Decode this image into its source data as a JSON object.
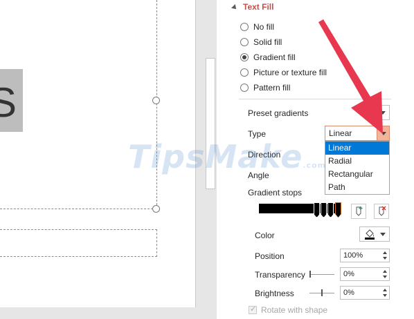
{
  "slide": {
    "shape_glyph": "S"
  },
  "pane": {
    "section_title": "Text Fill",
    "fill_options": [
      {
        "label": "No fill",
        "checked": false
      },
      {
        "label": "Solid fill",
        "checked": false
      },
      {
        "label": "Gradient fill",
        "checked": true
      },
      {
        "label": "Picture or texture fill",
        "checked": false
      },
      {
        "label": "Pattern fill",
        "checked": false
      }
    ],
    "preset_gradients_label": "Preset gradients",
    "type_label": "Type",
    "type_value": "Linear",
    "type_options": [
      "Linear",
      "Radial",
      "Rectangular",
      "Path"
    ],
    "type_selected": "Linear",
    "direction_label": "Direction",
    "angle_label": "Angle",
    "gradient_stops_label": "Gradient stops",
    "color_label": "Color",
    "position_label": "Position",
    "position_value": "100%",
    "transparency_label": "Transparency",
    "transparency_value": "0%",
    "brightness_label": "Brightness",
    "brightness_value": "0%",
    "rotate_label": "Rotate with shape",
    "rotate_checked": true
  },
  "watermark": {
    "brand": "TipsMake",
    "suffix": ".com"
  },
  "colors": {
    "accent_red": "#c0504d",
    "highlight_blue": "#0078d7",
    "arrow_red": "#e8384f"
  }
}
